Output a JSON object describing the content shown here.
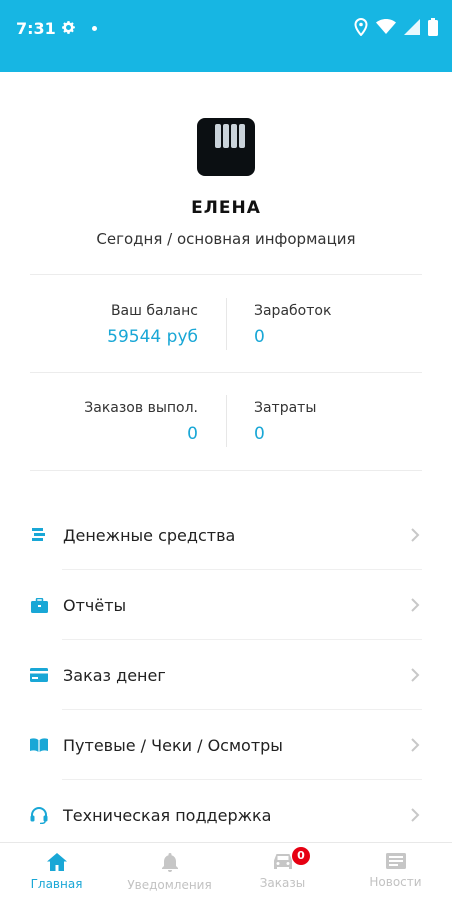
{
  "status_bar": {
    "time": "7:31"
  },
  "profile": {
    "name": "ЕЛЕНА",
    "subtitle": "Сегодня / основная информация"
  },
  "stats": {
    "balance_label": "Ваш баланс",
    "balance_value": "59544 руб",
    "earnings_label": "Заработок",
    "earnings_value": "0",
    "orders_label": "Заказов выпол.",
    "orders_value": "0",
    "expenses_label": "Затраты",
    "expenses_value": "0"
  },
  "menu": {
    "items": [
      {
        "label": "Денежные средства",
        "icon": "money-icon"
      },
      {
        "label": "Отчёты",
        "icon": "briefcase-icon"
      },
      {
        "label": "Заказ денег",
        "icon": "card-icon"
      },
      {
        "label": "Путевые / Чеки / Осмотры",
        "icon": "book-icon"
      },
      {
        "label": "Техническая поддержка",
        "icon": "headset-icon"
      }
    ]
  },
  "bottom_nav": {
    "items": [
      {
        "label": "Главная",
        "icon": "home-icon",
        "active": true
      },
      {
        "label": "Уведомления",
        "icon": "bell-icon",
        "active": false
      },
      {
        "label": "Заказы",
        "icon": "car-icon",
        "active": false,
        "badge": "0"
      },
      {
        "label": "Новости",
        "icon": "news-icon",
        "active": false
      }
    ]
  },
  "colors": {
    "accent": "#17b6e3",
    "value_text": "#19a7d6",
    "badge": "#e60012"
  }
}
